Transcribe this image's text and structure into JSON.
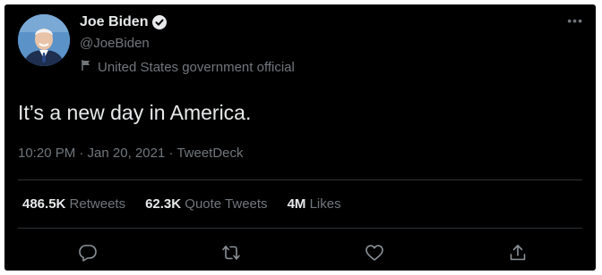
{
  "tweet": {
    "author_name": "Joe Biden",
    "handle": "@JoeBiden",
    "label": "United States government official",
    "text": "It’s a new day in America.",
    "timestamp": "10:20 PM · Jan 20, 2021 · TweetDeck",
    "more_icon": "more-horizontal-icon"
  },
  "stats": {
    "retweets_count": "486.5K",
    "retweets_label": "Retweets",
    "quotes_count": "62.3K",
    "quotes_label": "Quote Tweets",
    "likes_count": "4M",
    "likes_label": "Likes"
  },
  "actions": {
    "reply_icon": "reply-icon",
    "retweet_icon": "retweet-icon",
    "like_icon": "heart-icon",
    "share_icon": "share-icon"
  },
  "colors": {
    "background": "#000000",
    "primary_text": "#e7e9ea",
    "secondary_text": "#71767b",
    "divider": "#2f3336"
  }
}
